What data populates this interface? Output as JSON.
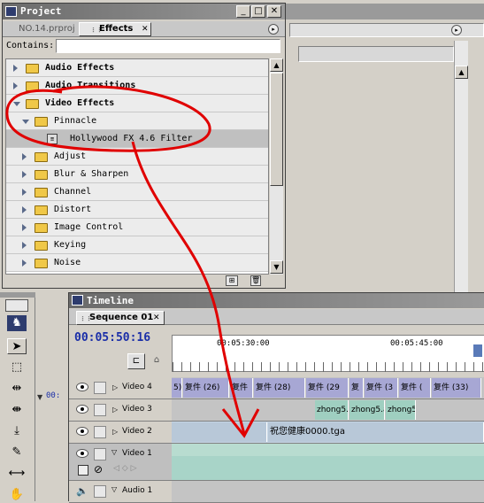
{
  "project_panel": {
    "title": "Project",
    "tabs": [
      {
        "label": "NO.14.prproj",
        "active": false
      },
      {
        "label": "Effects",
        "active": true
      }
    ],
    "contains_label": "Contains:",
    "contains_value": "",
    "tree": [
      {
        "label": "Audio Effects",
        "level": 0,
        "expanded": false,
        "bold": true,
        "type": "folder"
      },
      {
        "label": "Audio Transitions",
        "level": 0,
        "expanded": false,
        "bold": true,
        "type": "folder"
      },
      {
        "label": "Video Effects",
        "level": 0,
        "expanded": true,
        "bold": true,
        "type": "folder"
      },
      {
        "label": "Pinnacle",
        "level": 1,
        "expanded": true,
        "bold": false,
        "type": "folder"
      },
      {
        "label": "Hollywood FX 4.6 Filter",
        "level": 2,
        "expanded": false,
        "bold": false,
        "type": "effect",
        "selected": true
      },
      {
        "label": "Adjust",
        "level": 1,
        "expanded": false,
        "bold": false,
        "type": "folder"
      },
      {
        "label": "Blur & Sharpen",
        "level": 1,
        "expanded": false,
        "bold": false,
        "type": "folder"
      },
      {
        "label": "Channel",
        "level": 1,
        "expanded": false,
        "bold": false,
        "type": "folder"
      },
      {
        "label": "Distort",
        "level": 1,
        "expanded": false,
        "bold": false,
        "type": "folder"
      },
      {
        "label": "Image Control",
        "level": 1,
        "expanded": false,
        "bold": false,
        "type": "folder"
      },
      {
        "label": "Keying",
        "level": 1,
        "expanded": false,
        "bold": false,
        "type": "folder"
      },
      {
        "label": "Noise",
        "level": 1,
        "expanded": false,
        "bold": false,
        "type": "folder"
      }
    ]
  },
  "timeline_panel": {
    "title": "Timeline",
    "sequence_tab": "Sequence 01",
    "timecode": "00:05:50:16",
    "side_timecode": "00:",
    "ruler_labels": [
      "00:05:30:00",
      "00:05:45:00"
    ],
    "tracks": [
      {
        "label": "Video 4",
        "clips": [
          "5)",
          "复件 (26)",
          "复件",
          "复件 (28)",
          "复件 (29",
          "复",
          "复件 (3",
          "复件 (",
          "复件 (33)"
        ]
      },
      {
        "label": "Video 3",
        "clips": [
          "zhong5.",
          "zhong5.a",
          "zhong5"
        ]
      },
      {
        "label": "Video 2",
        "clips": [
          "祝您健康0000.tga"
        ]
      },
      {
        "label": "Video 1",
        "clips": [
          ""
        ]
      },
      {
        "label": "Audio 1",
        "clips": []
      }
    ]
  },
  "colors": {
    "annotation_red": "#e00000",
    "timecode_blue": "#1a2ea8",
    "clip_purple": "#a7a7d4",
    "clip_green": "#9fcfc0"
  }
}
